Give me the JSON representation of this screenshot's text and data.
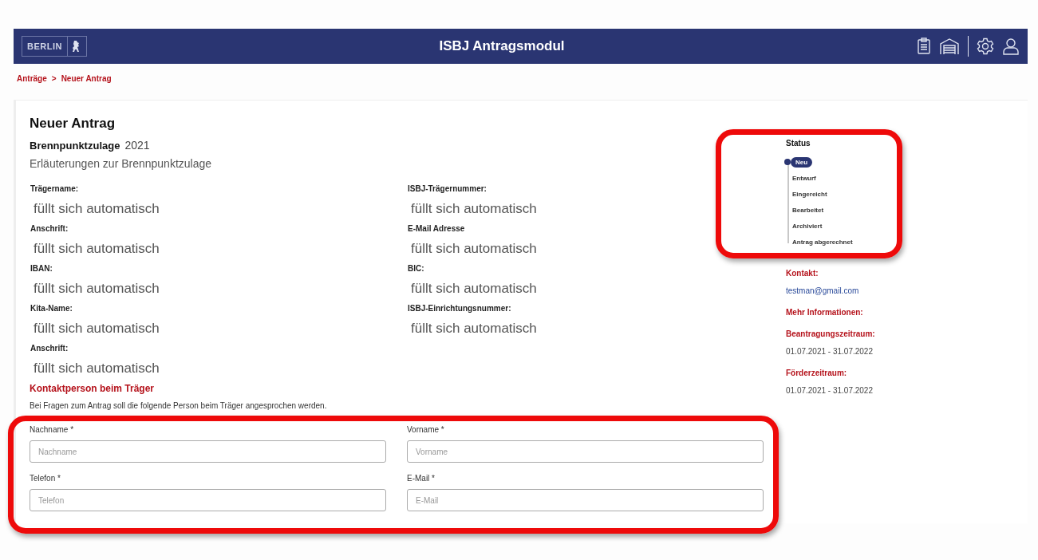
{
  "header": {
    "logo_text": "BERLIN",
    "title": "ISBJ Antragsmodul"
  },
  "breadcrumb": [
    {
      "label": "Anträge"
    },
    {
      "label": ">"
    },
    {
      "label": "Neuer Antrag"
    }
  ],
  "page_title": "Neuer Antrag",
  "program": {
    "name": "Brennpunktzulage",
    "year": "2021"
  },
  "explanation_link": "Erläuterungen zur Brennpunktzulage",
  "fields_left": [
    {
      "label": "Trägername:",
      "value": "füllt sich automatisch"
    },
    {
      "label": "Anschrift:",
      "value": "füllt sich automatisch"
    },
    {
      "label": "IBAN:",
      "value": "füllt sich automatisch"
    },
    {
      "label": "Kita-Name:",
      "value": "füllt sich automatisch"
    },
    {
      "label": "Anschrift:",
      "value": "füllt sich automatisch"
    }
  ],
  "fields_right": [
    {
      "label": "ISBJ-Trägernummer:",
      "value": "füllt sich automatisch"
    },
    {
      "label": "E-Mail Adresse",
      "value": "füllt sich automatisch"
    },
    {
      "label": "BIC:",
      "value": "füllt sich automatisch"
    },
    {
      "label": "ISBJ-Einrichtungsnummer:",
      "value": "füllt sich automatisch"
    }
  ],
  "contact_section": {
    "title": "Kontaktperson beim Träger",
    "description": "Bei Fragen zum Antrag soll die folgende Person beim Träger angesprochen werden."
  },
  "inputs": [
    {
      "label": "Nachname *",
      "placeholder": "Nachname"
    },
    {
      "label": "Vorname *",
      "placeholder": "Vorname"
    },
    {
      "label": "Telefon *",
      "placeholder": "Telefon"
    },
    {
      "label": "E-Mail *",
      "placeholder": "E-Mail"
    }
  ],
  "status": {
    "title": "Status",
    "steps": [
      {
        "label": "Neu",
        "selected": true
      },
      {
        "label": "Entwurf",
        "selected": false
      },
      {
        "label": "Eingereicht",
        "selected": false
      },
      {
        "label": "Bearbeitet",
        "selected": false
      },
      {
        "label": "Archiviert",
        "selected": false
      },
      {
        "label": "Antrag abgerechnet",
        "selected": false
      }
    ]
  },
  "info": [
    {
      "kind": "heading",
      "text": "Kontakt:"
    },
    {
      "kind": "link",
      "text": "testman@gmail.com"
    },
    {
      "kind": "heading",
      "text": "Mehr Informationen:"
    },
    {
      "kind": "heading",
      "text": "Beantragungszeitraum:"
    },
    {
      "kind": "text",
      "text": "01.07.2021 - 31.07.2022"
    },
    {
      "kind": "heading",
      "text": "Förderzeitraum:"
    },
    {
      "kind": "text",
      "text": "01.07.2021 - 31.07.2022"
    }
  ]
}
